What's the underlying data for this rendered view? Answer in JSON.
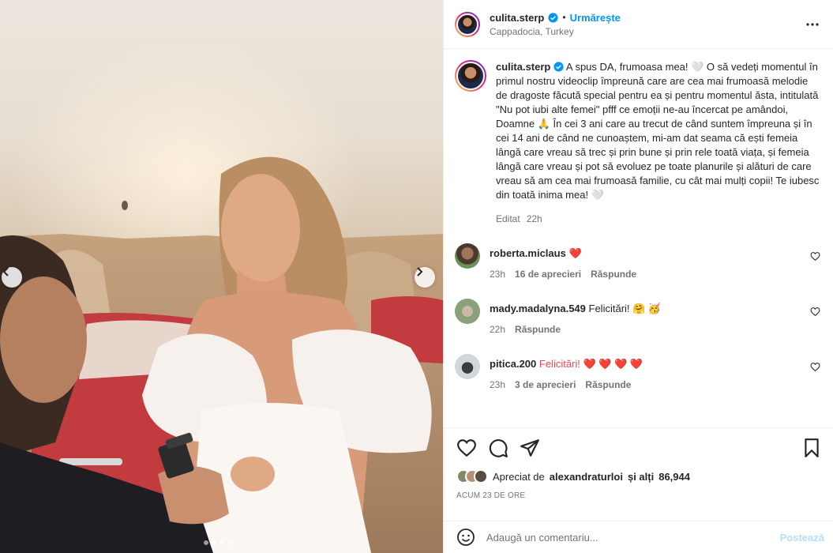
{
  "media": {
    "total_slides": 4,
    "active_slide": 2
  },
  "header": {
    "username": "culita.sterp",
    "separator": "•",
    "follow_label": "Urmărește",
    "location": "Cappadocia, Turkey"
  },
  "caption": {
    "username": "culita.sterp",
    "text": "A spus DA, frumoasa mea! 🤍 O să vedeți momentul în primul nostru videoclip împreună care are cea mai frumoasă melodie de dragoste făcută special pentru ea și pentru momentul ăsta, intitulată \"Nu pot iubi alte femei\" pfff ce emoții ne-au încercat pe amândoi, Doamne 🙏 În cei 3 ani care au trecut de când suntem împreuna și în cei 14 ani de când ne cunoaștem, mi-am dat seama că ești femeia lângă care vreau să trec și prin bune și prin rele toată viața, și femeia lângă care vreau și pot să evoluez pe toate planurile și alături de care vreau să am cea mai frumoasă familie, cu cât mai mulți copii! Te iubesc din toată inima mea! 🤍",
    "edited": "Editat",
    "time": "22h"
  },
  "comments": [
    {
      "username": "roberta.miclaus",
      "text": "❤️",
      "time": "23h",
      "likes": "16 de aprecieri",
      "reply": "Răspunde",
      "avatar_color": "#6b8f5a"
    },
    {
      "username": "mady.madalyna.549",
      "text": "Felicitări! 🤗 🥳",
      "time": "22h",
      "likes": "",
      "reply": "Răspunde",
      "avatar_color": "#8a9f7a"
    },
    {
      "username": "pitica.200",
      "text": "Felicitări! ❤️ ❤️ ❤️ ❤️",
      "time": "23h",
      "likes": "3 de aprecieri",
      "reply": "Răspunde",
      "avatar_color": "#cfd6dc"
    }
  ],
  "likes": {
    "prefix": "Apreciat de",
    "user": "alexandraturloi",
    "suffix": "și alți",
    "count": "86,944"
  },
  "date": "ACUM 23 DE ORE",
  "add_comment": {
    "placeholder": "Adaugă un comentariu...",
    "post_label": "Postează"
  },
  "colors": {
    "accent": "#0095f6",
    "like_red": "#ed4956",
    "muted": "#737373"
  }
}
